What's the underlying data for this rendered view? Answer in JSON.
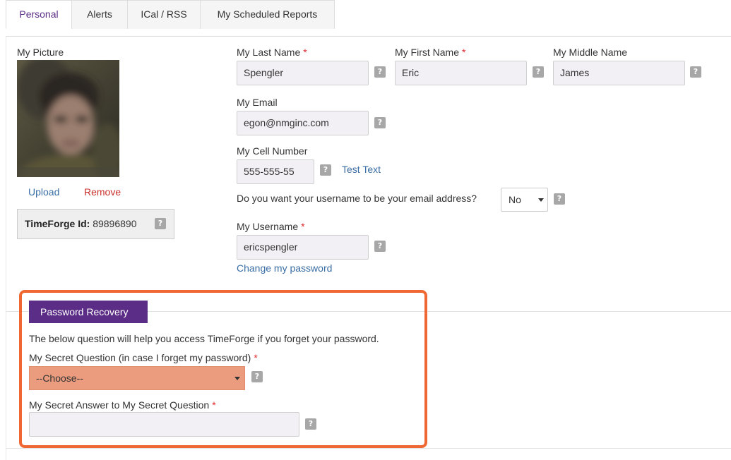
{
  "tabs": [
    "Personal",
    "Alerts",
    "ICal / RSS",
    "My Scheduled Reports"
  ],
  "picture": {
    "label": "My Picture",
    "upload": "Upload",
    "remove": "Remove"
  },
  "timeforge": {
    "label": "TimeForge Id:",
    "value": "89896890"
  },
  "help_glyph": "?",
  "required_mark": "*",
  "fields": {
    "last_name": {
      "label": "My Last Name",
      "value": "Spengler"
    },
    "first_name": {
      "label": "My First Name",
      "value": "Eric"
    },
    "middle_name": {
      "label": "My Middle Name",
      "value": "James"
    },
    "email": {
      "label": "My Email",
      "value": "egon@nmginc.com"
    },
    "cell": {
      "label": "My Cell Number",
      "value": "555-555-55",
      "test_link": "Test Text"
    },
    "username_question": {
      "label": "Do you want your username to be your email address?",
      "value": "No"
    },
    "username": {
      "label": "My Username",
      "value": "ericspengler"
    },
    "change_password": "Change my password"
  },
  "recovery": {
    "title": "Password Recovery",
    "intro": "The below question will help you access TimeForge if you forget your password.",
    "question_label": "My Secret Question (in case I forget my password)",
    "question_value": "--Choose--",
    "answer_label": "My Secret Answer to My Secret Question",
    "answer_value": ""
  },
  "colors": {
    "accent": "#5b2d86",
    "highlight_border": "#ef6833",
    "error_select": "#eb9c7e",
    "required": "#e0282d"
  }
}
